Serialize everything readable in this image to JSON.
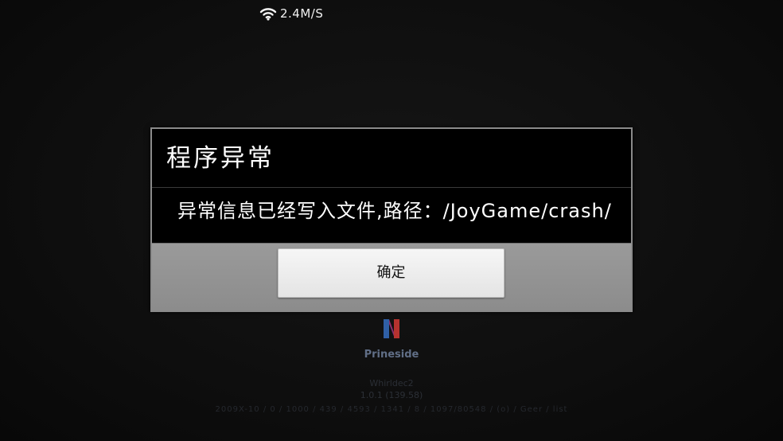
{
  "status_bar": {
    "wifi_icon": "wifi-icon",
    "speed": "2.4M/S"
  },
  "dialog": {
    "title": "程序异常",
    "message": "异常信息已经写入文件,路径：/JoyGame/crash/",
    "ok_label": "确定"
  },
  "background": {
    "logo_icon": "brand-logo-icon",
    "brand": "Prineside",
    "version_line_1": "Whirldec2",
    "version_line_2": "1.0.1 (139.58)",
    "version_line_3": "2009X-10 / 0 / 1000 / 439 / 4593 / 1341 / 8 / 1097/80548 / (o) / Geer / list"
  },
  "colors": {
    "dialog_bg": "#000000",
    "button_bar": "#9a9a9a",
    "button_face": "#f0f0f0",
    "brand_blue": "#2f6fb5",
    "brand_red": "#b5322f"
  }
}
